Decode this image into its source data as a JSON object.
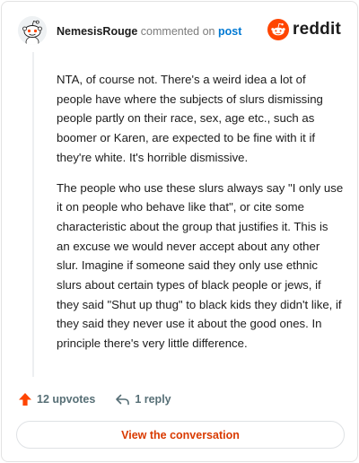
{
  "header": {
    "username": "NemesisRouge",
    "action_text": "commented on",
    "post_link": "post",
    "brand": "reddit"
  },
  "comment": {
    "paragraphs": [
      "NTA, of course not. There's a weird idea a lot of people have where the subjects of slurs dismissing people partly on their race, sex, age etc., such as boomer or Karen, are expected to be fine with it if they're white. It's horrible dismissive.",
      "The people who use these slurs always say \"I only use it on people who behave like that\", or cite some characteristic about the group that justifies it. This is an excuse we would never accept about any other slur. Imagine if someone said they only use ethnic slurs about certain types of black people or jews, if they said \"Shut up thug\" to black kids they didn't like, if they said they never use it about the good ones. In principle there's very little difference."
    ]
  },
  "actions": {
    "upvotes": "12 upvotes",
    "replies": "1 reply"
  },
  "cta": {
    "label": "View the conversation"
  },
  "colors": {
    "reddit_orange": "#ff4500",
    "link_blue": "#0079d3",
    "cta_text": "#d93a00",
    "meta_gray": "#576f76"
  },
  "icons": [
    "avatar-snoo",
    "reddit-logo-icon",
    "upvote-arrow-icon",
    "reply-icon"
  ]
}
